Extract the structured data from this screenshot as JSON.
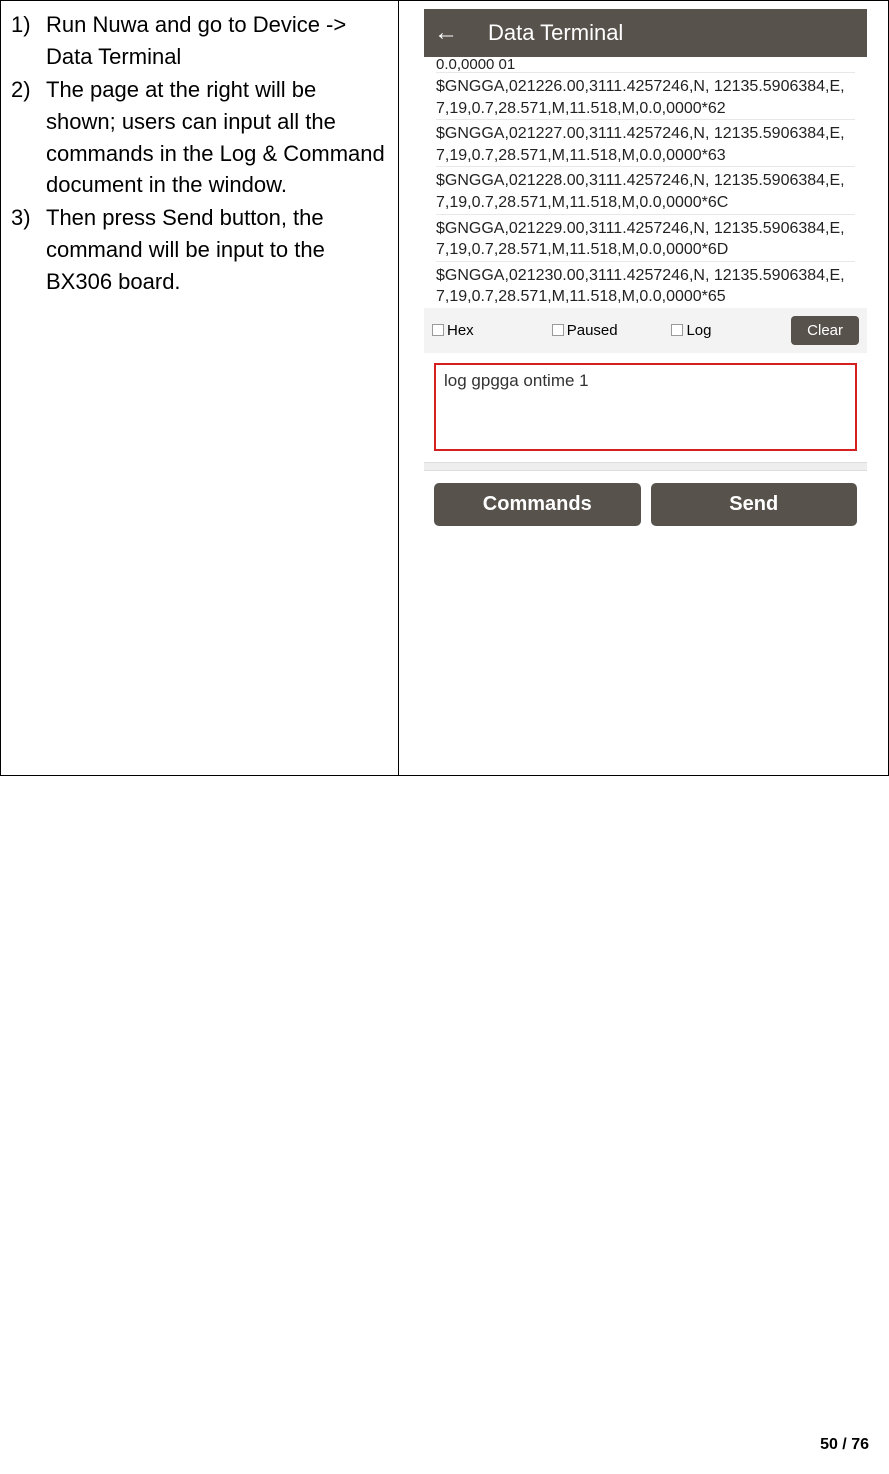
{
  "instructions": {
    "item1": "Run Nuwa and go to Device -> Data Terminal",
    "item2": "The page at the right will be shown; users can input all the commands in the Log & Command document in the window.",
    "item3": "Then press Send button, the command will be input to the BX306 board."
  },
  "phone": {
    "title": "Data Terminal",
    "log_cut": "0.0,0000  01",
    "lines": {
      "l1": "$GNGGA,021226.00,3111.4257246,N,\n12135.5906384,E,7,19,0.7,28.571,M,11.518,M,0.0,0000*62",
      "l2": "$GNGGA,021227.00,3111.4257246,N,\n12135.5906384,E,7,19,0.7,28.571,M,11.518,M,0.0,0000*63",
      "l3": "$GNGGA,021228.00,3111.4257246,N,\n12135.5906384,E,7,19,0.7,28.571,M,11.518,M,0.0,0000*6C",
      "l4": "$GNGGA,021229.00,3111.4257246,N,\n12135.5906384,E,7,19,0.7,28.571,M,11.518,M,0.0,0000*6D",
      "l5": "$GNGGA,021230.00,3111.4257246,N,\n12135.5906384,E,7,19,0.7,28.571,M,11.518,M,0.0,0000*65"
    },
    "controls": {
      "hex": "Hex",
      "paused": "Paused",
      "log": "Log",
      "clear": "Clear"
    },
    "input_value": "log gpgga ontime 1",
    "buttons": {
      "commands": "Commands",
      "send": "Send"
    }
  },
  "page_number": "50 / 76"
}
